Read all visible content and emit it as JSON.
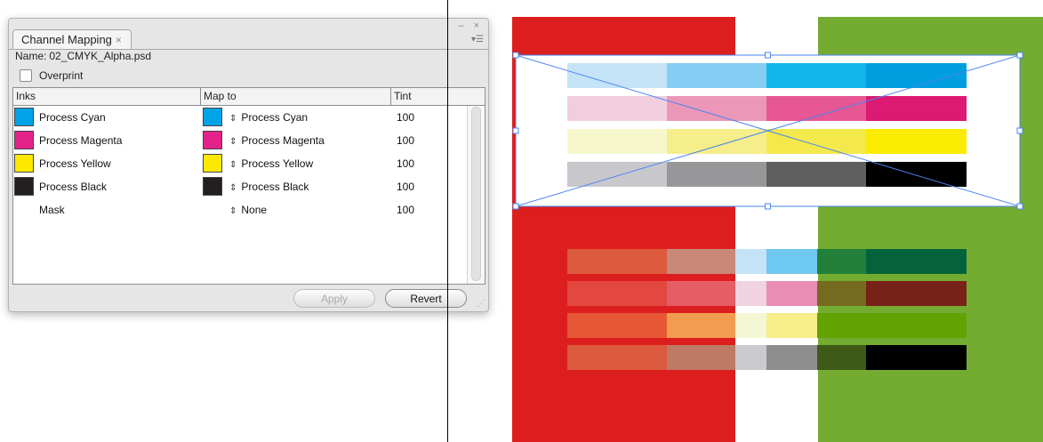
{
  "panel": {
    "title": "Channel Mapping",
    "tab_close": "×",
    "window_controls": "– ×",
    "menu_icon": "▾☰",
    "name_label": "Name:",
    "file_name": "02_CMYK_Alpha.psd",
    "overprint_label": "Overprint",
    "overprint_checked": false,
    "columns": {
      "inks": "Inks",
      "map_to": "Map to",
      "tint": "Tint"
    },
    "rows": [
      {
        "ink": "Process Cyan",
        "ink_color": "#00a3e6",
        "map_to": "Process Cyan",
        "map_color": "#00a3e6",
        "tint": "100"
      },
      {
        "ink": "Process Magenta",
        "ink_color": "#e4228a",
        "map_to": "Process Magenta",
        "map_color": "#e4228a",
        "tint": "100"
      },
      {
        "ink": "Process Yellow",
        "ink_color": "#fde800",
        "map_to": "Process Yellow",
        "map_color": "#fde800",
        "tint": "100"
      },
      {
        "ink": "Process Black",
        "ink_color": "#231f20",
        "map_to": "Process Black",
        "map_color": "#231f20",
        "tint": "100"
      },
      {
        "ink": "Mask",
        "ink_color": "",
        "map_to": "None",
        "map_color": "",
        "tint": "100"
      }
    ],
    "select_icon": "⇕",
    "apply_label": "Apply",
    "revert_label": "Revert",
    "apply_enabled": false
  },
  "artwork": {
    "colors": {
      "red": "#dc1e1e",
      "green": "#74ab31",
      "selection": "#4a86f0"
    },
    "top_bars": [
      [
        "#c5e3f6",
        "#85cdf2",
        "#10b6ec",
        "#009ddf"
      ],
      [
        "#f1cedd",
        "#ec97b8",
        "#e65794",
        "#dc1a73"
      ],
      [
        "#f6f7cb",
        "#f5ee8a",
        "#f3e84c",
        "#faeb00"
      ],
      [
        "#c8c7cc",
        "#979799",
        "#5f5f5f",
        "#000000"
      ]
    ],
    "bottom_bars": [
      [
        "#dc5a3e",
        "#c9897a",
        "#c5e3f6",
        "#6fc8ef",
        "#22803a",
        "#05633b"
      ],
      [
        "#e24740",
        "#e55e66",
        "#f1d2df",
        "#ea8cb3",
        "#746b1f",
        "#782119"
      ],
      [
        "#e75735",
        "#f29c4f",
        "#f5f7d4",
        "#f7ee8a",
        "#64a201",
        "#64a201"
      ],
      [
        "#dc5a3e",
        "#bd7b65",
        "#cbcacf",
        "#8e8e8e",
        "#3d5a17",
        "#000000"
      ]
    ]
  }
}
